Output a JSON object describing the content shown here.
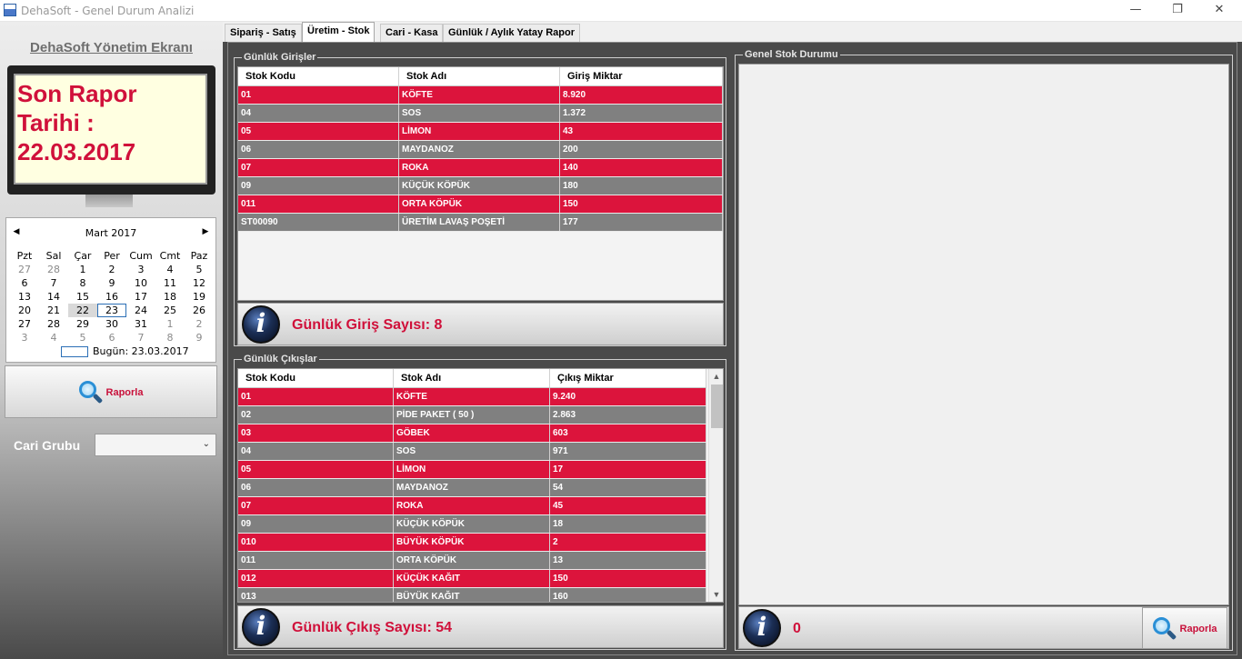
{
  "window": {
    "title": "DehaSoft - Genel Durum Analizi",
    "minimize_glyph": "—",
    "restore_glyph": "❐",
    "close_glyph": "✕"
  },
  "left_panel": {
    "title": "DehaSoft Yönetim Ekranı",
    "report_date_lines": [
      "Son Rapor",
      "Tarihi :",
      "22.03.2017"
    ],
    "calendar": {
      "month_label": "Mart 2017",
      "prev_glyph": "◀",
      "next_glyph": "▶",
      "weekdays": [
        "Pzt",
        "Sal",
        "Çar",
        "Per",
        "Cum",
        "Cmt",
        "Paz"
      ],
      "weeks": [
        [
          "27",
          "28",
          "1",
          "2",
          "3",
          "4",
          "5"
        ],
        [
          "6",
          "7",
          "8",
          "9",
          "10",
          "11",
          "12"
        ],
        [
          "13",
          "14",
          "15",
          "16",
          "17",
          "18",
          "19"
        ],
        [
          "20",
          "21",
          "22",
          "23",
          "24",
          "25",
          "26"
        ],
        [
          "27",
          "28",
          "29",
          "30",
          "31",
          "1",
          "2"
        ],
        [
          "3",
          "4",
          "5",
          "6",
          "7",
          "8",
          "9"
        ]
      ],
      "selected_day": "22",
      "today_day": "23",
      "today_label": "Bugün: 23.03.2017"
    },
    "raporla_label": "Raporla",
    "cari_grubu_label": "Cari Grubu",
    "cari_grubu_value": ""
  },
  "tabs": [
    {
      "label": "Sipariş - Satış",
      "active": false
    },
    {
      "label": "Üretim - Stok",
      "active": true
    },
    {
      "label": "Cari - Kasa",
      "active": false
    },
    {
      "label": "Günlük / Aylık Yatay Rapor",
      "active": false
    }
  ],
  "gunluk_girisler": {
    "title": "Günlük Girişler",
    "columns": [
      "Stok Kodu",
      "Stok Adı",
      "Giriş Miktar"
    ],
    "rows": [
      [
        "01",
        "KÖFTE",
        "8.920"
      ],
      [
        "04",
        "SOS",
        "1.372"
      ],
      [
        "05",
        "LİMON",
        "43"
      ],
      [
        "06",
        "MAYDANOZ",
        "200"
      ],
      [
        "07",
        "ROKA",
        "140"
      ],
      [
        "09",
        "KÜÇÜK KÖPÜK",
        "180"
      ],
      [
        "011",
        "ORTA KÖPÜK",
        "150"
      ],
      [
        "ST00090",
        " ÜRETİM LAVAŞ POŞETİ",
        "177"
      ]
    ],
    "summary": "Günlük Giriş Sayısı: 8"
  },
  "gunluk_cikislar": {
    "title": "Günlük Çıkışlar",
    "columns": [
      "Stok Kodu",
      "Stok Adı",
      "Çıkış Miktar"
    ],
    "rows": [
      [
        "01",
        "KÖFTE",
        "9.240"
      ],
      [
        "02",
        "PİDE PAKET ( 50 )",
        "2.863"
      ],
      [
        "03",
        "GÖBEK",
        "603"
      ],
      [
        "04",
        "SOS",
        "971"
      ],
      [
        "05",
        "LİMON",
        "17"
      ],
      [
        "06",
        "MAYDANOZ",
        "54"
      ],
      [
        "07",
        "ROKA",
        "45"
      ],
      [
        "09",
        "KÜÇÜK KÖPÜK",
        "18"
      ],
      [
        "010",
        "BÜYÜK KÖPÜK",
        "2"
      ],
      [
        "011",
        "ORTA KÖPÜK",
        "13"
      ],
      [
        "012",
        "KÜÇÜK KAĞIT",
        "150"
      ],
      [
        "013",
        "BÜYÜK KAĞIT",
        "160"
      ]
    ],
    "summary": "Günlük Çıkış Sayısı: 54",
    "scroll_up_glyph": "▲",
    "scroll_down_glyph": "▼"
  },
  "genel_stok": {
    "title": "Genel Stok Durumu",
    "count": "0",
    "raporla_label": "Raporla"
  },
  "info_glyph": "i",
  "colors": {
    "row_red": "#dc143c",
    "row_gray": "#808080",
    "accent_red": "#d0103a"
  }
}
